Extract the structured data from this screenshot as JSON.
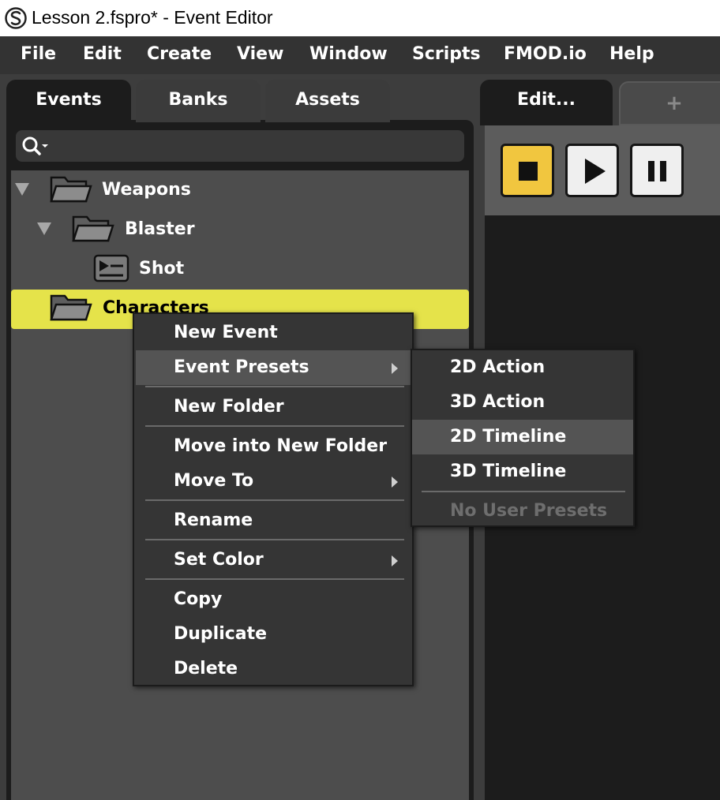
{
  "window": {
    "title": "Lesson 2.fspro* - Event Editor"
  },
  "menubar": {
    "items": [
      "File",
      "Edit",
      "Create",
      "View",
      "Window",
      "Scripts",
      "FMOD.io",
      "Help"
    ]
  },
  "browser": {
    "tabs": [
      {
        "label": "Events",
        "active": true
      },
      {
        "label": "Banks",
        "active": false
      },
      {
        "label": "Assets",
        "active": false
      }
    ],
    "search": {
      "placeholder": "",
      "value": ""
    },
    "tree": [
      {
        "label": "Weapons",
        "type": "folder",
        "expanded": true,
        "depth": 0
      },
      {
        "label": "Blaster",
        "type": "folder",
        "expanded": true,
        "depth": 1
      },
      {
        "label": "Shot",
        "type": "event",
        "depth": 2
      },
      {
        "label": "Characters",
        "type": "folder",
        "selected": true,
        "depth": 0
      }
    ]
  },
  "editor": {
    "tabs": [
      {
        "label": "Edit...",
        "active": true
      },
      {
        "label": "+",
        "active": false
      }
    ],
    "transport": {
      "stop_color": "#f1c63f"
    }
  },
  "context_menu": {
    "items": [
      {
        "label": "New Event"
      },
      {
        "label": "Event Presets",
        "submenu": true,
        "highlighted": true
      },
      {
        "label": "New Folder"
      },
      {
        "label": "Move into New Folder"
      },
      {
        "label": "Move To",
        "submenu": true
      },
      {
        "label": "Rename"
      },
      {
        "label": "Set Color",
        "submenu": true
      },
      {
        "label": "Copy"
      },
      {
        "label": "Duplicate"
      },
      {
        "label": "Delete"
      }
    ],
    "submenu": {
      "items": [
        {
          "label": "2D Action"
        },
        {
          "label": "3D Action"
        },
        {
          "label": "2D Timeline",
          "highlighted": true
        },
        {
          "label": "3D Timeline"
        },
        {
          "label": "No User Presets",
          "disabled": true
        }
      ]
    }
  },
  "colors": {
    "selection": "#e5e34a",
    "menubar": "#333333",
    "panel": "#1c1c1c",
    "tree_bg": "#4d4d4d"
  }
}
